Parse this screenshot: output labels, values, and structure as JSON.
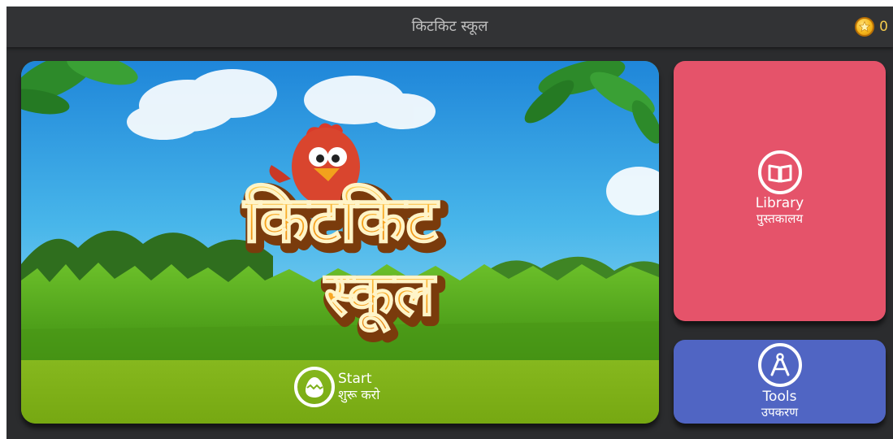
{
  "app": {
    "title": "किटकिट स्कूल"
  },
  "coins": {
    "count": "0",
    "icon": "star-coin-icon"
  },
  "hero": {
    "logo_line1": "किटकिट",
    "logo_line2": "स्कूल",
    "mascot": "chicken-mascot",
    "start_label_en": "Start",
    "start_label_hi": "शुरू करो",
    "start_icon": "egg-icon"
  },
  "library": {
    "label_en": "Library",
    "label_hi": "पुस्तकालय",
    "icon": "book-icon"
  },
  "tools": {
    "label_en": "Tools",
    "label_hi": "उपकरण",
    "icon": "compass-icon"
  },
  "colors": {
    "library_bg": "#e5536a",
    "tools_bg": "#5065c3",
    "start_bar_bg": "#7fb11c",
    "topbar_bg": "#323335",
    "app_bg": "#2b2c2e"
  }
}
